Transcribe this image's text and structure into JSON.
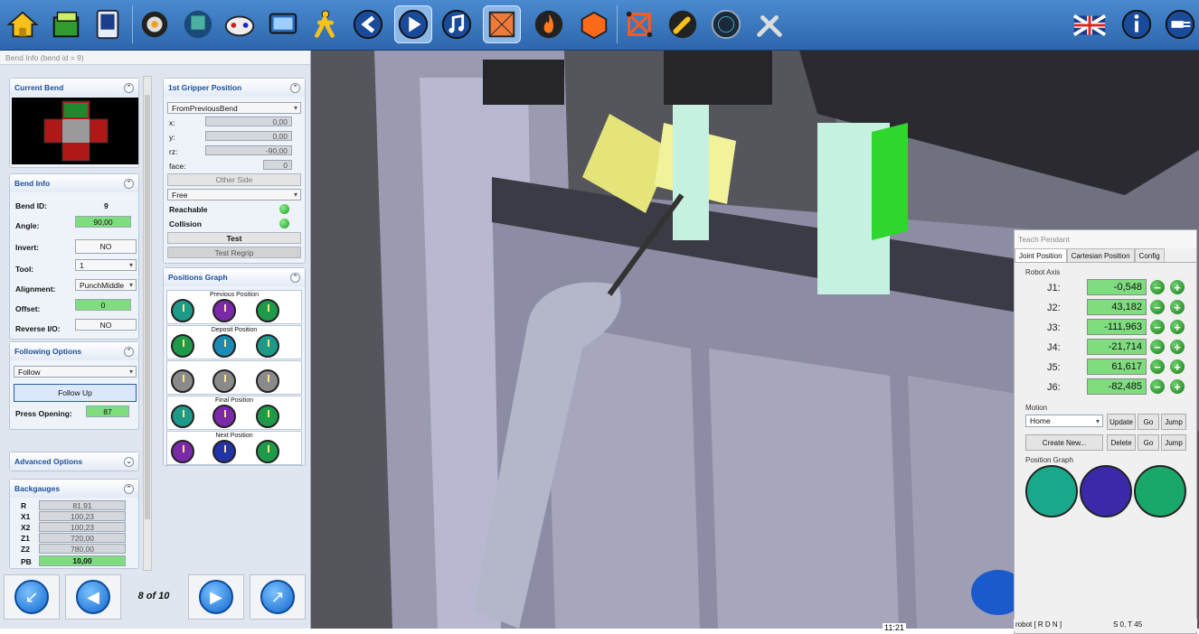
{
  "toolbar": {
    "icons": [
      "home-icon",
      "folder-icon",
      "machine-icon",
      "gears-icon",
      "tool-icon",
      "gamepad-icon",
      "display-icon",
      "walker-icon",
      "undo-icon",
      "play-icon",
      "music-icon",
      "frame-icon",
      "fire-icon",
      "block-icon",
      "structure-icon",
      "wrench-icon",
      "radar-icon",
      "tools-icon",
      "uk-flag-icon",
      "info-icon",
      "connect-icon"
    ]
  },
  "bend_panel": {
    "title": "Bend Info (bend id = 9)",
    "current_bend": {
      "header": "Current Bend"
    },
    "bend_info": {
      "header": "Bend Info",
      "bend_id_label": "Bend ID:",
      "bend_id": "9",
      "angle_label": "Angle:",
      "angle": "90,00",
      "invert_label": "Invert:",
      "invert": "NO",
      "tool_label": "Tool:",
      "tool": "1",
      "alignment_label": "Alignment:",
      "alignment": "PunchMiddle",
      "offset_label": "Offset:",
      "offset": "0",
      "reverse_label": "Reverse I/O:",
      "reverse": "NO"
    },
    "following": {
      "header": "Following Options",
      "mode": "Follow",
      "follow_up_label": "Follow Up",
      "press_opening_label": "Press Opening:",
      "press_opening": "87"
    },
    "advanced": {
      "header": "Advanced Options"
    },
    "backgauges": {
      "header": "Backgauges",
      "rows": [
        {
          "label": "R",
          "value": "81,91"
        },
        {
          "label": "X1",
          "value": "100,23"
        },
        {
          "label": "X2",
          "value": "100,23"
        },
        {
          "label": "Z1",
          "value": "720,00"
        },
        {
          "label": "Z2",
          "value": "780,00"
        },
        {
          "label": "PB",
          "value": "10,00"
        }
      ]
    },
    "gripper": {
      "header": "1st Gripper Position",
      "source": "FromPreviousBend",
      "x_label": "x:",
      "x": "0,00",
      "y_label": "y:",
      "y": "0,00",
      "rz_label": "rz:",
      "rz": "-90,00",
      "face_label": "face:",
      "face": "0",
      "other_side_label": "Other Side",
      "mode": "Free",
      "reachable_label": "Reachable",
      "collision_label": "Collision",
      "test_label": "Test",
      "test_regrip_label": "Test Regrip"
    },
    "positions_graph": {
      "header": "Positions Graph",
      "groups": [
        "Previous Position",
        "Deposit Position",
        "",
        "Final Position",
        "Next Position"
      ]
    },
    "pager": {
      "label": "8 of 10"
    }
  },
  "teach_pendant": {
    "title": "Teach Pendant",
    "tabs": [
      "Joint Position",
      "Cartesian Position",
      "Config"
    ],
    "robot_axis_label": "Robot Axis",
    "joints": [
      {
        "label": "J1:",
        "value": "-0,548"
      },
      {
        "label": "J2:",
        "value": "43,182"
      },
      {
        "label": "J3:",
        "value": "-111,963"
      },
      {
        "label": "J4:",
        "value": "-21,714"
      },
      {
        "label": "J5:",
        "value": "61,617"
      },
      {
        "label": "J6:",
        "value": "-82,485"
      }
    ],
    "motion_label": "Motion",
    "motion_select": "Home",
    "update_label": "Update",
    "go_label": "Go",
    "jump_label": "Jump",
    "create_new_label": "Create New...",
    "delete_label": "Delete",
    "position_graph_label": "Position Graph"
  },
  "status": {
    "left": "robot  [ R D N ]",
    "right": "S 0, T 45"
  },
  "clock": "11:21"
}
